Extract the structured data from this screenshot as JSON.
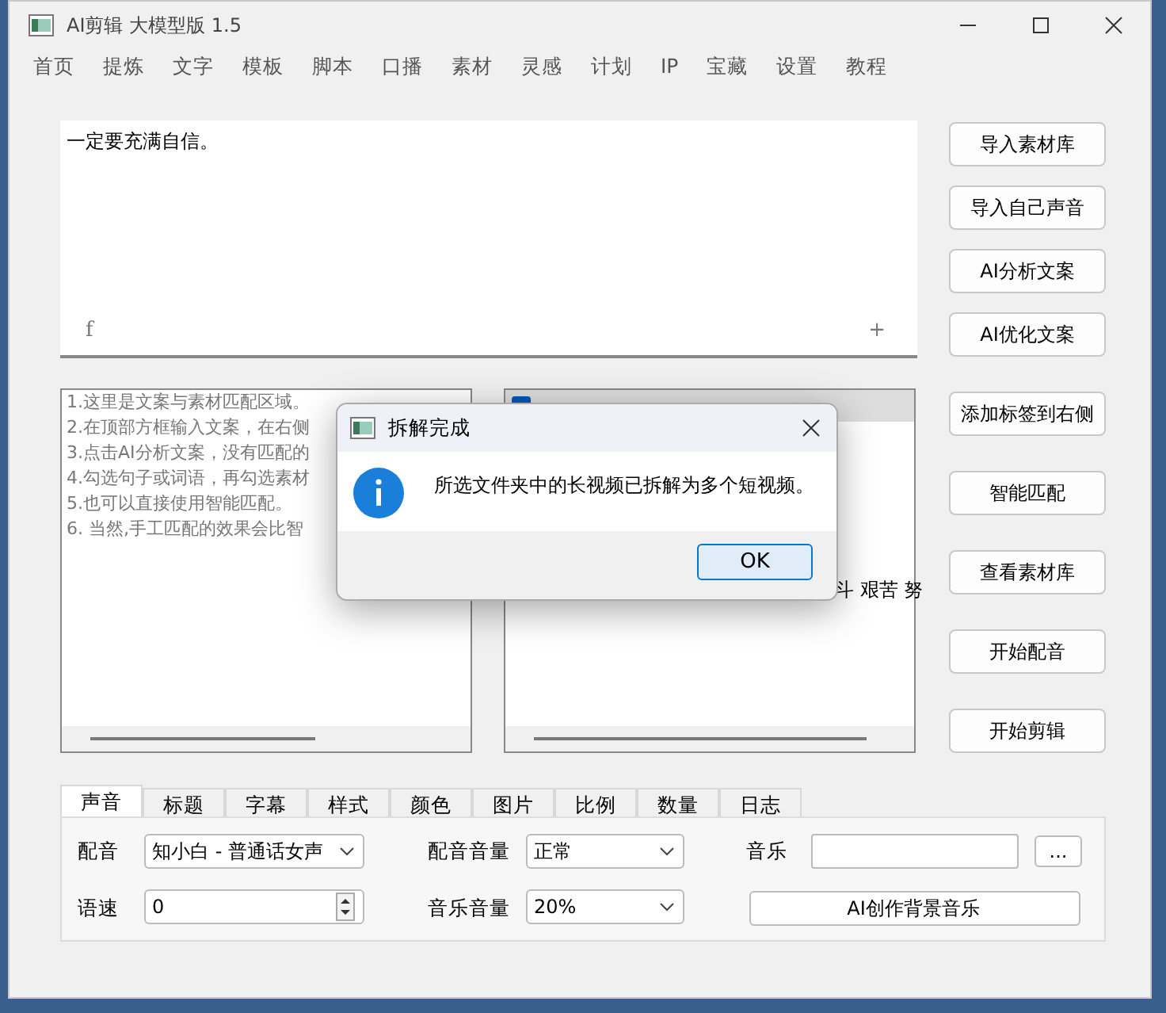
{
  "window": {
    "title": "AI剪辑 大模型版 1.5"
  },
  "menu": [
    "首页",
    "提炼",
    "文字",
    "模板",
    "脚本",
    "口播",
    "素材",
    "灵感",
    "计划",
    "IP",
    "宝藏",
    "设置",
    "教程"
  ],
  "editor": {
    "value": "一定要充满自信。",
    "left_glyph": "f",
    "right_glyph": "+"
  },
  "side_buttons": [
    "导入素材库",
    "导入自己声音",
    "AI分析文案",
    "AI优化文案",
    "添加标签到右侧",
    "智能匹配",
    "查看素材库",
    "开始配音",
    "开始剪辑"
  ],
  "left_list": {
    "lines": [
      "1.这里是文案与素材匹配区域。",
      "2.在顶部方框输入文案，在右侧",
      "3.点击AI分析文案，没有匹配的",
      "4.勾选句子或词语，再勾选素材",
      "5.也可以直接使用智能匹配。",
      "6.  当然,手工匹配的效果会比智"
    ]
  },
  "right_list": {
    "header_checked": true,
    "fragment": "斗 艰苦 努"
  },
  "tabs": [
    {
      "label": "声音",
      "selected": true
    },
    {
      "label": "标题",
      "selected": false
    },
    {
      "label": "字幕",
      "selected": false
    },
    {
      "label": "样式",
      "selected": false
    },
    {
      "label": "颜色",
      "selected": false
    },
    {
      "label": "图片",
      "selected": false
    },
    {
      "label": "比例",
      "selected": false
    },
    {
      "label": "数量",
      "selected": false
    },
    {
      "label": "日志",
      "selected": false
    }
  ],
  "sound": {
    "voice_label": "配音",
    "voice": "知小白 - 普通话女声",
    "voice_volume_label": "配音音量",
    "voice_volume": "正常",
    "music_label": "音乐",
    "browse": "...",
    "speed_label": "语速",
    "speed": "0",
    "music_volume_label": "音乐音量",
    "music_volume": "20%",
    "ai_music": "AI创作背景音乐"
  },
  "dialog": {
    "title": "拆解完成",
    "message": "所选文件夹中的长视频已拆解为多个短视频。",
    "ok": "OK"
  }
}
